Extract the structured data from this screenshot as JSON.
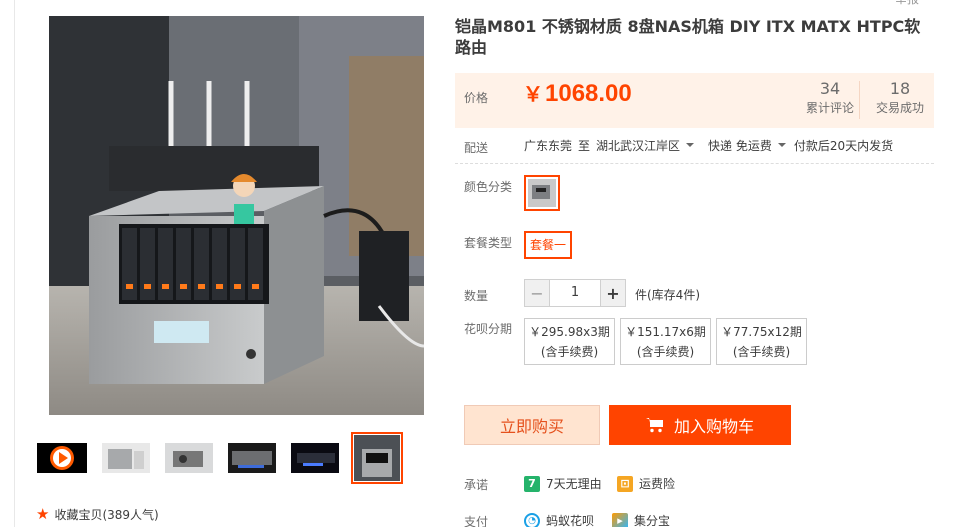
{
  "title": "铠晶M801 不锈钢材质 8盘NAS机箱 DIY ITX MATX HTPC软路由",
  "corner_text": "举报",
  "price": {
    "label": "价格",
    "currency": "￥",
    "value": "1068.00",
    "reviews_count": "34",
    "reviews_label": "累计评论",
    "sales_count": "18",
    "sales_label": "交易成功"
  },
  "delivery": {
    "label": "配送",
    "from": "广东东莞",
    "to_word": "至",
    "destination": "湖北武汉江岸区",
    "shipping": "快递 免运费",
    "dispatch": "付款后20天内发货"
  },
  "color": {
    "label": "颜色分类"
  },
  "package": {
    "label": "套餐类型",
    "option": "套餐一"
  },
  "quantity": {
    "label": "数量",
    "minus": "−",
    "value": "1",
    "plus": "+",
    "stock": "件(库存4件)"
  },
  "installments": {
    "label": "花呗分期",
    "options": [
      {
        "line1": "￥295.98x3期",
        "line2": "(含手续费)"
      },
      {
        "line1": "￥151.17x6期",
        "line2": "(含手续费)"
      },
      {
        "line1": "￥77.75x12期",
        "line2": "(含手续费)"
      }
    ]
  },
  "actions": {
    "buy_now": "立即购买",
    "add_to_cart": "加入购物车"
  },
  "promise": {
    "label": "承诺",
    "items": [
      "7天无理由",
      "运费险"
    ]
  },
  "payment": {
    "label": "支付",
    "items": [
      "蚂蚁花呗",
      "集分宝"
    ]
  },
  "favorite": {
    "label": "收藏宝贝",
    "count": "(389人气)"
  },
  "colors": {
    "accent": "#ff4400",
    "price_bg": "#fff2e8",
    "buy_now_bg": "#ffe4d0"
  }
}
